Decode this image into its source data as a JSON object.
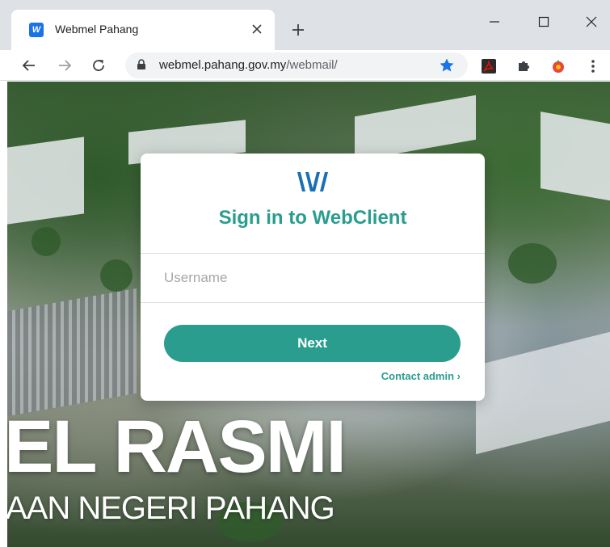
{
  "browser": {
    "tab": {
      "favicon_letter": "W",
      "title": "Webmel Pahang"
    },
    "address_bar": {
      "domain": "webmel.pahang.gov.my",
      "path": "/webmail/"
    },
    "icons": {
      "close_tab": "close-icon",
      "new_tab": "plus-icon",
      "back": "arrow-left-icon",
      "forward": "arrow-right-icon",
      "reload": "reload-icon",
      "lock": "lock-icon",
      "bookmark": "star-icon",
      "pdf_extension": "acrobat-icon",
      "extensions": "puzzle-icon",
      "profile_extension": "extension-icon",
      "menu": "kebab-menu-icon"
    }
  },
  "login": {
    "title": "Sign in to WebClient",
    "username_placeholder": "Username",
    "next_label": "Next",
    "contact_label": "Contact admin ›"
  },
  "background": {
    "watermark_line1": "EL RASMI",
    "watermark_line2": "AAN NEGERI PAHANG"
  },
  "colors": {
    "accent": "#2a9d8f",
    "favicon": "#1a73e8",
    "bookmark_star": "#1a73e8"
  }
}
